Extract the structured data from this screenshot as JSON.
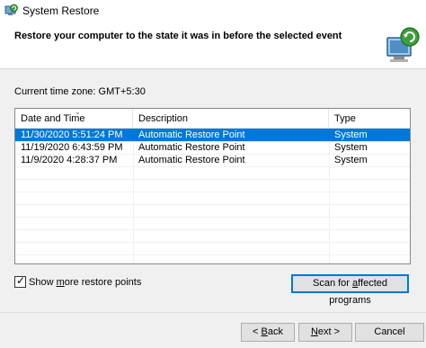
{
  "window": {
    "title": "System Restore",
    "icon": "system-restore-icon"
  },
  "header": {
    "instruction": "Restore your computer to the state it was in before the selected event",
    "icon": "system-restore-computer-icon"
  },
  "timezone": "Current time zone: GMT+5:30",
  "table": {
    "columns": [
      "Date and Time",
      "Description",
      "Type"
    ],
    "sorted_column": "Date and Time",
    "selected_row": 0,
    "rows": [
      {
        "date": "11/30/2020 5:51:24 PM",
        "description": "Automatic Restore Point",
        "type": "System"
      },
      {
        "date": "11/19/2020 6:43:59 PM",
        "description": "Automatic Restore Point",
        "type": "System"
      },
      {
        "date": "11/9/2020 4:28:37 PM",
        "description": "Automatic Restore Point",
        "type": "System"
      }
    ]
  },
  "show_more": {
    "pre": "Show ",
    "accel": "m",
    "post": "ore restore points",
    "checked": true
  },
  "scan_button": {
    "pre": "Scan for ",
    "accel": "a",
    "post": "ffected programs"
  },
  "footer": {
    "back": {
      "pre": "< ",
      "accel": "B",
      "post": "ack"
    },
    "next": {
      "pre": "",
      "accel": "N",
      "post": "ext >"
    },
    "cancel": "Cancel"
  },
  "colors": {
    "selection": "#0078d7",
    "background": "#f0f0f0"
  }
}
